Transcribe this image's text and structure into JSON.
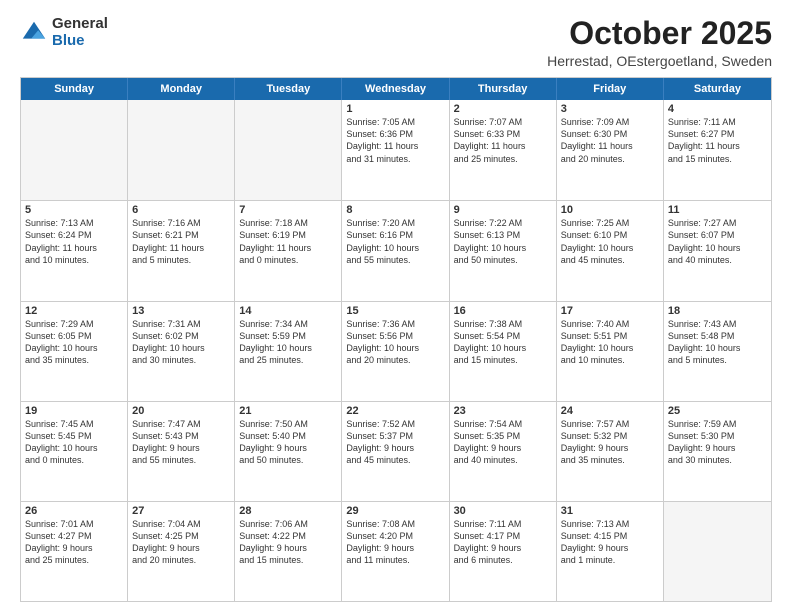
{
  "logo": {
    "general": "General",
    "blue": "Blue"
  },
  "title": "October 2025",
  "location": "Herrestad, OEstergoetland, Sweden",
  "days": [
    "Sunday",
    "Monday",
    "Tuesday",
    "Wednesday",
    "Thursday",
    "Friday",
    "Saturday"
  ],
  "weeks": [
    [
      {
        "day": "",
        "content": "",
        "empty": true
      },
      {
        "day": "",
        "content": "",
        "empty": true
      },
      {
        "day": "",
        "content": "",
        "empty": true
      },
      {
        "day": "1",
        "content": "Sunrise: 7:05 AM\nSunset: 6:36 PM\nDaylight: 11 hours\nand 31 minutes.",
        "empty": false
      },
      {
        "day": "2",
        "content": "Sunrise: 7:07 AM\nSunset: 6:33 PM\nDaylight: 11 hours\nand 25 minutes.",
        "empty": false
      },
      {
        "day": "3",
        "content": "Sunrise: 7:09 AM\nSunset: 6:30 PM\nDaylight: 11 hours\nand 20 minutes.",
        "empty": false
      },
      {
        "day": "4",
        "content": "Sunrise: 7:11 AM\nSunset: 6:27 PM\nDaylight: 11 hours\nand 15 minutes.",
        "empty": false
      }
    ],
    [
      {
        "day": "5",
        "content": "Sunrise: 7:13 AM\nSunset: 6:24 PM\nDaylight: 11 hours\nand 10 minutes.",
        "empty": false
      },
      {
        "day": "6",
        "content": "Sunrise: 7:16 AM\nSunset: 6:21 PM\nDaylight: 11 hours\nand 5 minutes.",
        "empty": false
      },
      {
        "day": "7",
        "content": "Sunrise: 7:18 AM\nSunset: 6:19 PM\nDaylight: 11 hours\nand 0 minutes.",
        "empty": false
      },
      {
        "day": "8",
        "content": "Sunrise: 7:20 AM\nSunset: 6:16 PM\nDaylight: 10 hours\nand 55 minutes.",
        "empty": false
      },
      {
        "day": "9",
        "content": "Sunrise: 7:22 AM\nSunset: 6:13 PM\nDaylight: 10 hours\nand 50 minutes.",
        "empty": false
      },
      {
        "day": "10",
        "content": "Sunrise: 7:25 AM\nSunset: 6:10 PM\nDaylight: 10 hours\nand 45 minutes.",
        "empty": false
      },
      {
        "day": "11",
        "content": "Sunrise: 7:27 AM\nSunset: 6:07 PM\nDaylight: 10 hours\nand 40 minutes.",
        "empty": false
      }
    ],
    [
      {
        "day": "12",
        "content": "Sunrise: 7:29 AM\nSunset: 6:05 PM\nDaylight: 10 hours\nand 35 minutes.",
        "empty": false
      },
      {
        "day": "13",
        "content": "Sunrise: 7:31 AM\nSunset: 6:02 PM\nDaylight: 10 hours\nand 30 minutes.",
        "empty": false
      },
      {
        "day": "14",
        "content": "Sunrise: 7:34 AM\nSunset: 5:59 PM\nDaylight: 10 hours\nand 25 minutes.",
        "empty": false
      },
      {
        "day": "15",
        "content": "Sunrise: 7:36 AM\nSunset: 5:56 PM\nDaylight: 10 hours\nand 20 minutes.",
        "empty": false
      },
      {
        "day": "16",
        "content": "Sunrise: 7:38 AM\nSunset: 5:54 PM\nDaylight: 10 hours\nand 15 minutes.",
        "empty": false
      },
      {
        "day": "17",
        "content": "Sunrise: 7:40 AM\nSunset: 5:51 PM\nDaylight: 10 hours\nand 10 minutes.",
        "empty": false
      },
      {
        "day": "18",
        "content": "Sunrise: 7:43 AM\nSunset: 5:48 PM\nDaylight: 10 hours\nand 5 minutes.",
        "empty": false
      }
    ],
    [
      {
        "day": "19",
        "content": "Sunrise: 7:45 AM\nSunset: 5:45 PM\nDaylight: 10 hours\nand 0 minutes.",
        "empty": false
      },
      {
        "day": "20",
        "content": "Sunrise: 7:47 AM\nSunset: 5:43 PM\nDaylight: 9 hours\nand 55 minutes.",
        "empty": false
      },
      {
        "day": "21",
        "content": "Sunrise: 7:50 AM\nSunset: 5:40 PM\nDaylight: 9 hours\nand 50 minutes.",
        "empty": false
      },
      {
        "day": "22",
        "content": "Sunrise: 7:52 AM\nSunset: 5:37 PM\nDaylight: 9 hours\nand 45 minutes.",
        "empty": false
      },
      {
        "day": "23",
        "content": "Sunrise: 7:54 AM\nSunset: 5:35 PM\nDaylight: 9 hours\nand 40 minutes.",
        "empty": false
      },
      {
        "day": "24",
        "content": "Sunrise: 7:57 AM\nSunset: 5:32 PM\nDaylight: 9 hours\nand 35 minutes.",
        "empty": false
      },
      {
        "day": "25",
        "content": "Sunrise: 7:59 AM\nSunset: 5:30 PM\nDaylight: 9 hours\nand 30 minutes.",
        "empty": false
      }
    ],
    [
      {
        "day": "26",
        "content": "Sunrise: 7:01 AM\nSunset: 4:27 PM\nDaylight: 9 hours\nand 25 minutes.",
        "empty": false
      },
      {
        "day": "27",
        "content": "Sunrise: 7:04 AM\nSunset: 4:25 PM\nDaylight: 9 hours\nand 20 minutes.",
        "empty": false
      },
      {
        "day": "28",
        "content": "Sunrise: 7:06 AM\nSunset: 4:22 PM\nDaylight: 9 hours\nand 15 minutes.",
        "empty": false
      },
      {
        "day": "29",
        "content": "Sunrise: 7:08 AM\nSunset: 4:20 PM\nDaylight: 9 hours\nand 11 minutes.",
        "empty": false
      },
      {
        "day": "30",
        "content": "Sunrise: 7:11 AM\nSunset: 4:17 PM\nDaylight: 9 hours\nand 6 minutes.",
        "empty": false
      },
      {
        "day": "31",
        "content": "Sunrise: 7:13 AM\nSunset: 4:15 PM\nDaylight: 9 hours\nand 1 minute.",
        "empty": false
      },
      {
        "day": "",
        "content": "",
        "empty": true
      }
    ]
  ]
}
